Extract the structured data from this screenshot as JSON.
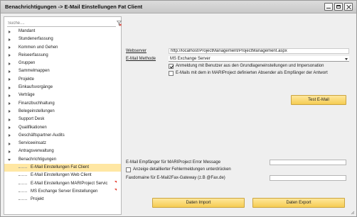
{
  "window": {
    "title": "Benachrichtigungen -> E-Mail Einstellungen Fat Client"
  },
  "sidebar": {
    "search_placeholder": "Suche....",
    "items": [
      {
        "label": "Mandant"
      },
      {
        "label": "Stundenerfassung"
      },
      {
        "label": "Kommen und Gehen"
      },
      {
        "label": "Reiseerfassung"
      },
      {
        "label": "Gruppen"
      },
      {
        "label": "Sammelmappen"
      },
      {
        "label": "Projekte"
      },
      {
        "label": "Einkaufsvorgänge"
      },
      {
        "label": "Verträge"
      },
      {
        "label": "Finanzbuchhaltung"
      },
      {
        "label": "Belegeinstellungen"
      },
      {
        "label": "Support Desk"
      },
      {
        "label": "Qualifikationen"
      },
      {
        "label": "Geschäftspartner-Audits"
      },
      {
        "label": "Serviceeinsatz"
      },
      {
        "label": "Antragsverwaltung"
      },
      {
        "label": "Benachrichtigungen"
      }
    ],
    "children": [
      {
        "label": "E-Mail Einstellungen Fat Client"
      },
      {
        "label": "E-Mail Einstellungen Web Client"
      },
      {
        "label": "E-Mail Einstellungen MARIProject Servic"
      },
      {
        "label": "MS Exchange Server Einstellungen"
      },
      {
        "label": "Projekt"
      }
    ]
  },
  "form": {
    "webserver_label": "Webserver",
    "webserver_value": "http://localhost/ProjectManagement/ProjectManagement.aspx",
    "email_method_label": "E-Mail Methode",
    "email_method_value": "MS Exchange Server",
    "cb_login_label": "Anmeldung mit Benutzer aus den Grundlageneinstellungen und Impersonation",
    "cb_sender_label": "E-Mails mit dem in MARIProject definierten Absender als Empfänger der Antwort",
    "test_button": "Test E-Mail",
    "error_recipient_label": "E-Mail Empfänger für MARIProject Error Message",
    "error_recipient_value": "",
    "cb_details_label": "Anzeige detaillierter Fehlermeldungen unterdrücken",
    "fax_label": "Faxdomaine für E-Mail2Fax-Gateway (z.B @Fax.de)",
    "fax_value": "",
    "import_button": "Daten Import",
    "export_button": "Daten Export"
  }
}
